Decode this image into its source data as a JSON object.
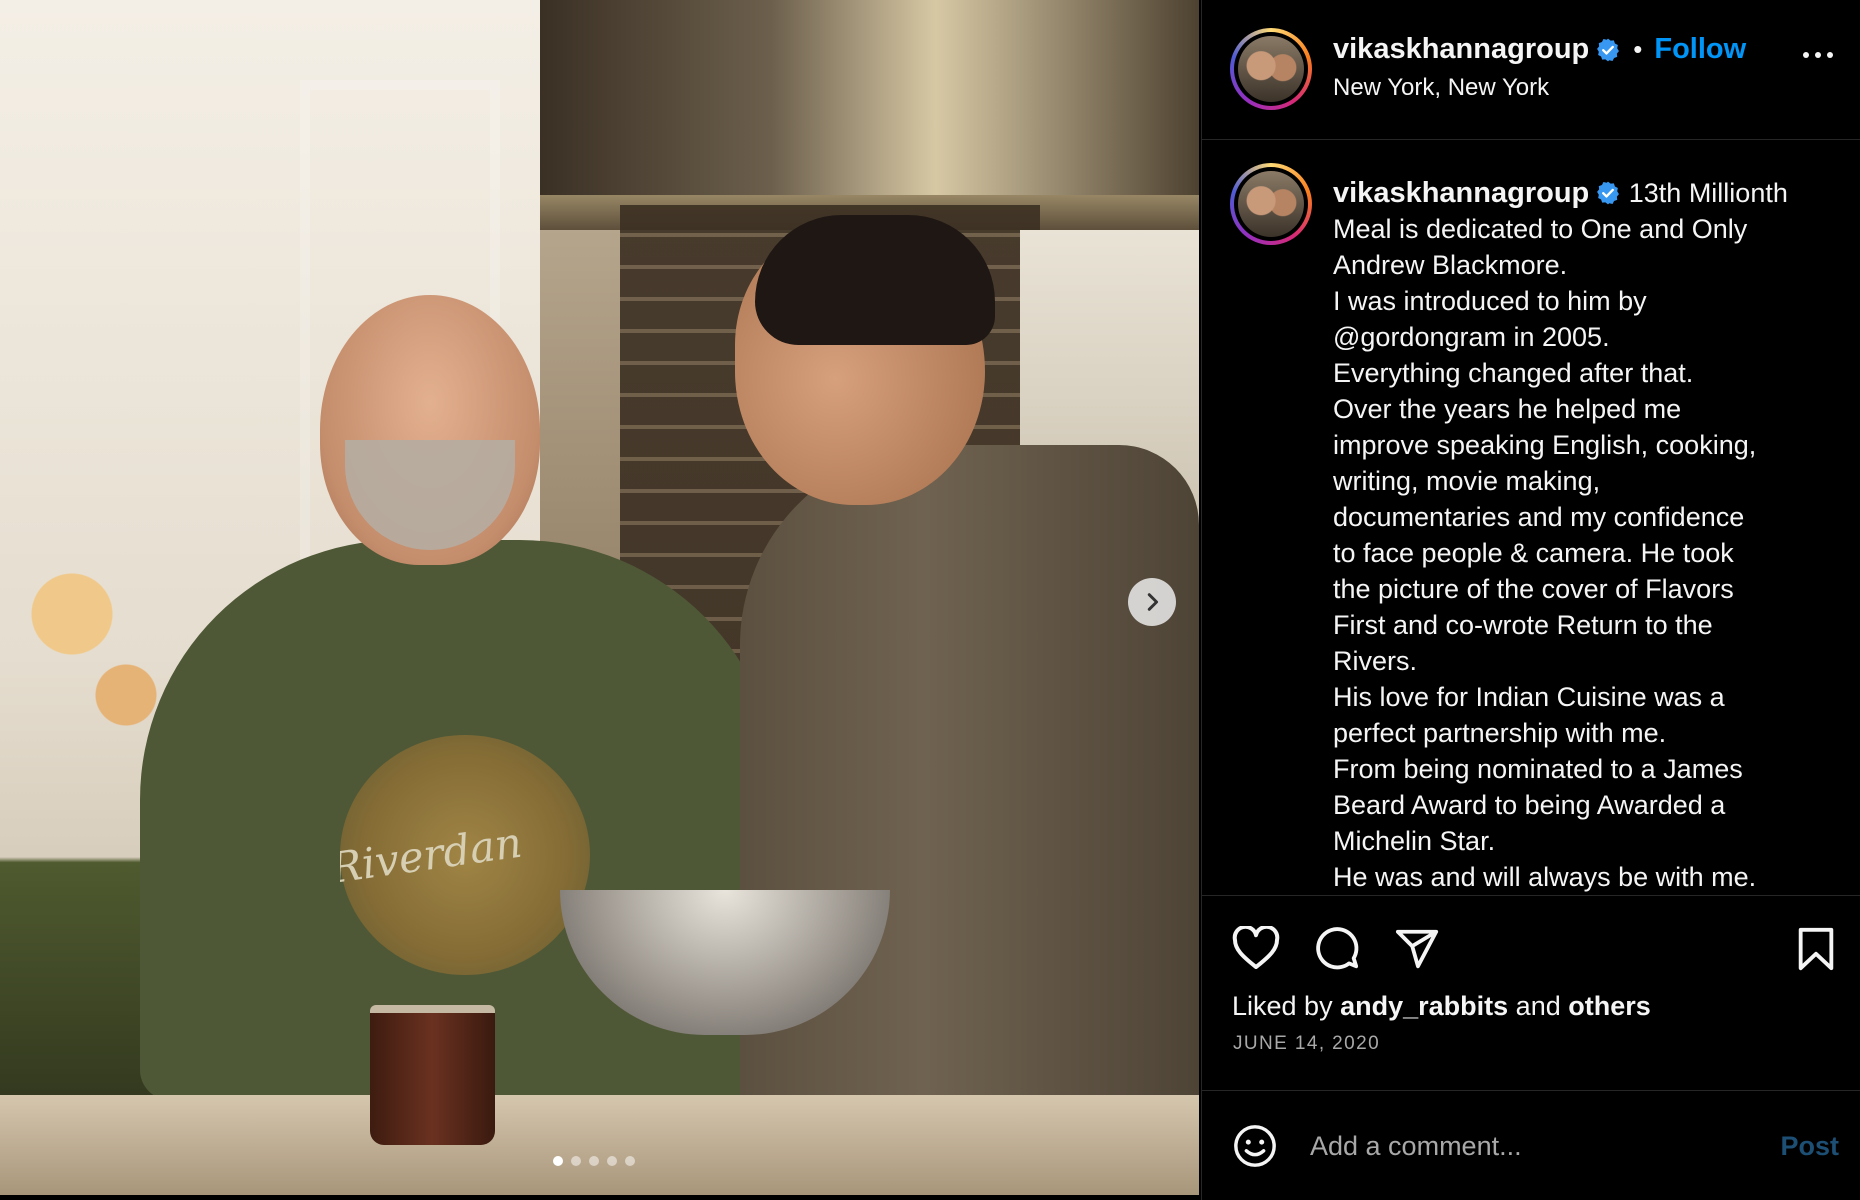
{
  "post": {
    "username": "vikaskhannagroup",
    "follow_separator": "•",
    "follow_label": "Follow",
    "location": "New York, New York",
    "caption_lines": [
      "13th Millionth",
      "Meal is dedicated to One and Only",
      "Andrew Blackmore.",
      "I was introduced to him by",
      "@gordongram in 2005.",
      "Everything changed after that.",
      "Over the years he helped me",
      "improve speaking English, cooking,",
      "writing, movie making,",
      "documentaries and my confidence",
      "to face people & camera. He took",
      "the picture of the cover of Flavors",
      "First and co-wrote Return to the",
      "Rivers.",
      "His love for Indian Cuisine was a",
      "perfect partnership with me.",
      "From being nominated to a James",
      "Beard Award to being Awarded a",
      "Michelin Star.",
      "He was and will always be with me."
    ],
    "liked_prefix": "Liked by",
    "liked_user": "andy_rabbits",
    "liked_and": "and",
    "liked_others": "others",
    "date": "JUNE 14, 2020",
    "photo_shirt_text": "Riverdan"
  },
  "comment": {
    "placeholder": "Add a comment...",
    "post_label": "Post"
  },
  "carousel": {
    "dot_count": 5,
    "active_index": 0
  },
  "icons": {
    "verified": "verified-badge-icon",
    "more": "more-options-icon",
    "like": "heart-icon",
    "comment": "comment-icon",
    "share": "share-icon",
    "save": "bookmark-icon",
    "emoji": "emoji-icon",
    "next": "chevron-right-icon"
  },
  "colors": {
    "background": "#000000",
    "text": "#f5f5f5",
    "accent": "#0095f6",
    "muted": "#a8a8a8",
    "verified": "#3897f0",
    "post_disabled": "#1d4f75"
  }
}
